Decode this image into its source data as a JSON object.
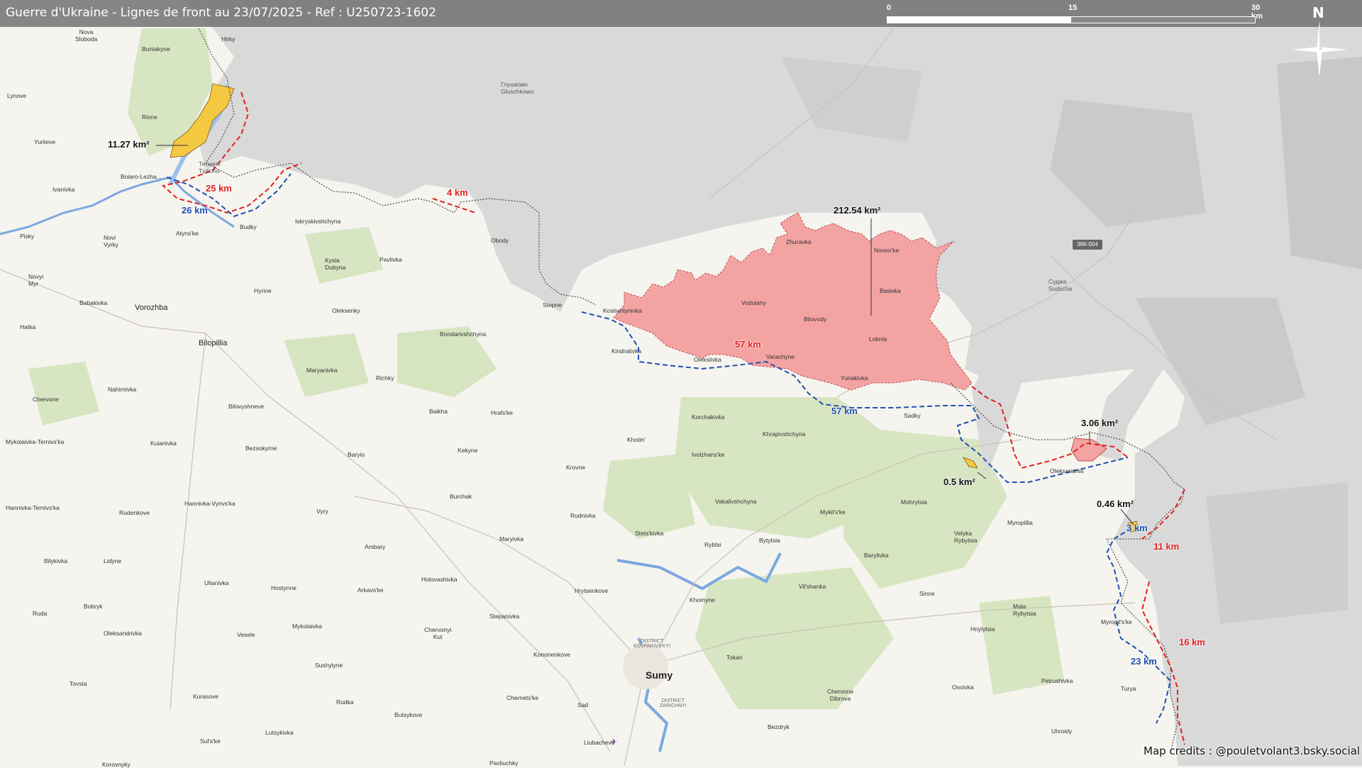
{
  "header": {
    "title": "Guerre d'Ukraine - Lignes de front au 23/07/2025 - Ref : U250723-1602",
    "scale_labels": [
      "0",
      "15",
      "30 km"
    ],
    "north_label": "N"
  },
  "credits": "Map credits : @pouletvolant3.bsky.social",
  "colors": {
    "russia_fill": "#d8d8d8",
    "occupied_red": "#f4a0a0",
    "occupied_yellow": "#f5c842",
    "red_line": "#e02020",
    "blue_line": "#1f4fb0",
    "border_line": "#333333",
    "forest": "#cfe0b4",
    "river": "#6fa0e0"
  },
  "areas": [
    {
      "id": "area-1",
      "label": "11.27 km²",
      "color": "yellow"
    },
    {
      "id": "area-2",
      "label": "212.54 km²",
      "color": "red"
    },
    {
      "id": "area-3",
      "label": "3.06 km²",
      "color": "red"
    },
    {
      "id": "area-4",
      "label": "0.5 km²",
      "color": "yellow"
    },
    {
      "id": "area-5",
      "label": "0.46 km²",
      "color": "yellow"
    }
  ],
  "distances": [
    {
      "label": "25 km",
      "color": "red"
    },
    {
      "label": "26 km",
      "color": "blue"
    },
    {
      "label": "4 km",
      "color": "red"
    },
    {
      "label": "57 km",
      "color": "red"
    },
    {
      "label": "57 km",
      "color": "blue"
    },
    {
      "label": "3 km",
      "color": "blue"
    },
    {
      "label": "11 km",
      "color": "red"
    },
    {
      "label": "16 km",
      "color": "red"
    },
    {
      "label": "23 km",
      "color": "blue"
    }
  ],
  "road_badge": "38К-004",
  "places": {
    "nova_sloboda": "Nova\nSloboda",
    "hirky": "Hirky",
    "buniakyne": "Buniakyne",
    "lynove": "Lynove",
    "rivne": "Rivne",
    "yuriieve": "Yuriieve",
    "tetkino": "Теткино\nTjotkino",
    "boiaro_lezhachi": "Boiaro-Lezha...",
    "ivanivka": "Ivanivka",
    "pisky": "Pisky",
    "novi_vyrky": "Novi\nVyrky",
    "atyns_ke": "Atyns'ke",
    "budky": "Budky",
    "iskryskivshchyna": "Iskryskivshchyna",
    "glushkovo": "Глушково\nGluschkowo",
    "obody": "Obody",
    "kysla_dubyna": "Kysla\nDubyna",
    "pavlivka": "Pavlivka",
    "novyi_myr": "Novyi\nMyr",
    "hyrine": "Hyrine",
    "babakivka": "Babakivka",
    "vorozhba": "Vorozhba",
    "oleksenky": "Oleksenky",
    "stepne": "Stepne",
    "kostiantynivka": "Kostiantynivka",
    "hatka": "Hatka",
    "bilopillia": "Bilopillia",
    "bondarivshchyna": "Bondarivshchyna",
    "zhuravka": "Zhuravka",
    "novenke": "Noven'ke",
    "vodolahy": "Vodolahy",
    "basivka": "Basivka",
    "bilovody": "Bilovody",
    "loknia": "Loknia",
    "kindrativka": "Kindrativka",
    "oleksiivka": "Oleksiivka",
    "varachyne": "Varachyne",
    "yunakivka": "Yunakivka",
    "sudzha": "Суджа\nSudscha",
    "maryanivka": "Maryanivka",
    "richky": "Richky",
    "nahirnivka": "Nahirnivka",
    "chervone": "Chervone",
    "bilovyshneve": "Bilovyshneve",
    "baikha": "Baikha",
    "hrafske": "Hrafs'ke",
    "korchakivka": "Korchakivka",
    "khrapivshchyna": "Khrapivshchyna",
    "sadky": "Sadky",
    "mykolaivka_ternivska": "Mykolaivka-Ternivs'ka",
    "kuianivka": "Kuianivka",
    "bezsokyrne": "Bezsokyrne",
    "baryio": "Baryio",
    "kekyne": "Kekyne",
    "khotin": "Khotin'",
    "ivolzhanske": "Ivolzhans'ke",
    "krovne": "Krovne",
    "oleksandriia": "Oleksandriia",
    "hannivka_ternivska": "Hannivka-Ternivs'ka",
    "hannivka_vyrivska": "Hannivka-Vyrivs'ka",
    "rudenkove": "Rudenkove",
    "burchak": "Burchak",
    "vyry": "Vyry",
    "rudnivka": "Rudnivka",
    "vakalivshchyna": "Vakalivshchyna",
    "mykilske": "Mykil's'ke",
    "mohrytsia": "Mohrytsia",
    "myropillia": "Myropillia",
    "velyka_rybytsia": "Velyka\nRybytsia",
    "bilykivka": "Bilykivka",
    "lidyne": "Lidyne",
    "ambary": "Ambary",
    "maryivka": "Maryivka",
    "stetskivka": "Stets'kivka",
    "rybtsi": "Rybtsi",
    "bytytsia": "Bytytsia",
    "barylivka": "Barylivka",
    "ulianivka": "Ulianivka",
    "hostynne": "Hostynne",
    "arkavske": "Arkavs'ke",
    "holovashivka": "Holovashivka",
    "hrytsenkove": "Hrytsenkove",
    "vilshanka": "Vil'shanka",
    "sinne": "Sinne",
    "bobryk": "Bobryk",
    "ruda": "Ruda",
    "khomyne": "Khomyne",
    "mala_rybytsia": "Mala\nRybytsia",
    "mykolaivka": "Mykolaivka",
    "stepanivka": "Stepanivka",
    "oleksandrivka": "Oleksandrivka",
    "vesele": "Vesele",
    "chervonyi_kut": "Chervonyi\nKut",
    "district_kovpakivskyi": "DISTRICT\nKOVPAKIVS'KYI",
    "myropilske": "Myropil's'ke",
    "hnylytsia": "Hnylytsia",
    "kononenkove": "Kononenkove",
    "sushylyne": "Sushylyne",
    "tokari": "Tokari",
    "sumy": "Sumy",
    "tovsta": "Tovsta",
    "petrushivka": "Petrushivka",
    "chernetske": "Chernets'ke",
    "kurasove": "Kurasove",
    "rudka": "Rudka",
    "district_zarichnyi": "DISTRICT\nZARICHNYI",
    "chervona_dibrova": "Chervona\nDibrova",
    "osoivka": "Osoivka",
    "turya": "Turya",
    "sad": "Sad",
    "butsykove": "Butsykove",
    "bezdryk": "Bezdryk",
    "uhroidy": "Uhroidy",
    "lutsykivka": "Lutsykivka",
    "sulske": "Sul's'ke",
    "liubacheve": "Liubacheve",
    "pavliuchky": "Pavliuchky",
    "korovnyky": "Korovnyky",
    "zhuravka_ru": "Zhuravka"
  }
}
